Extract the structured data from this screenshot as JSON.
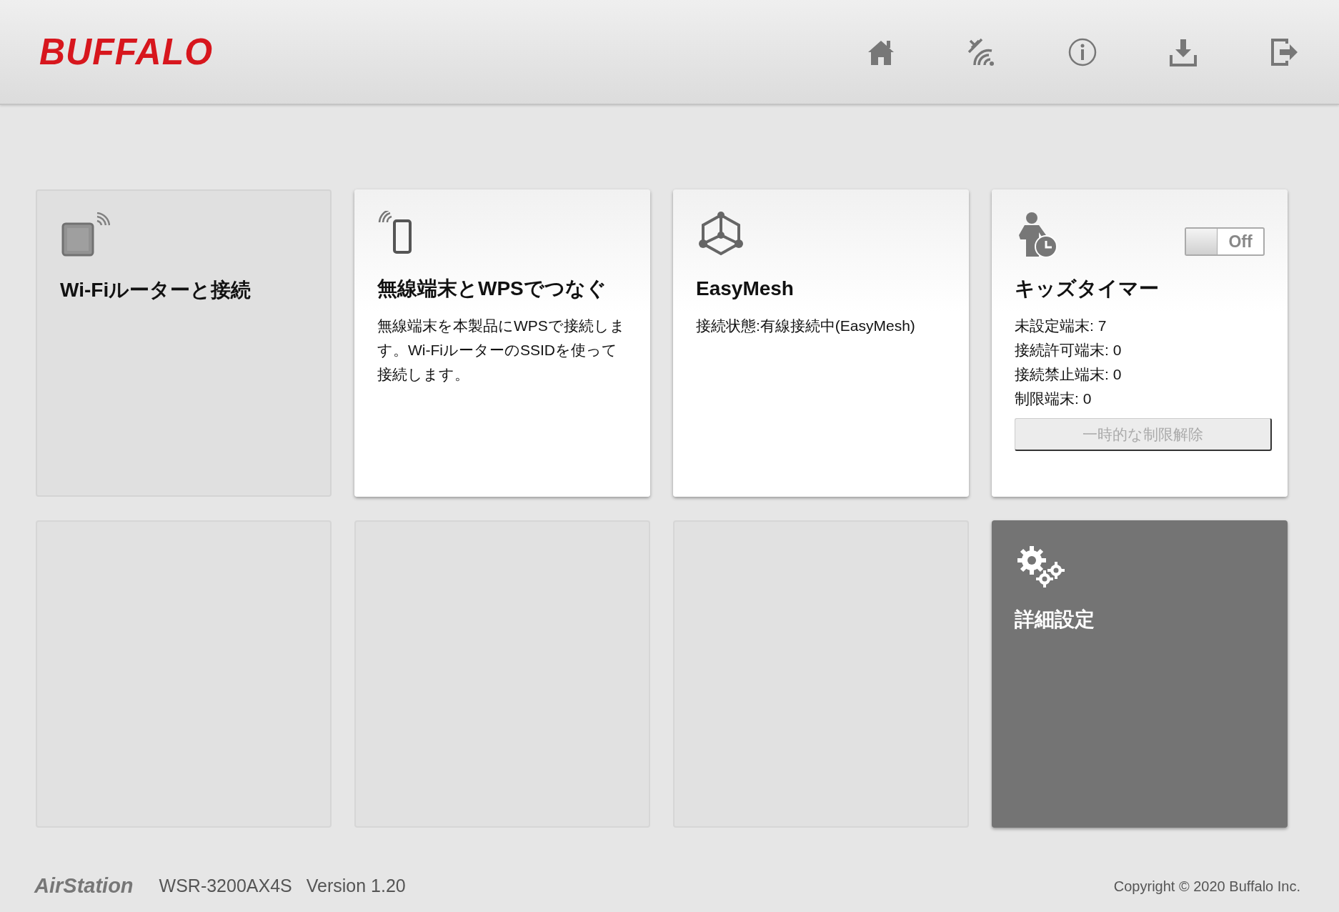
{
  "header": {
    "logo": "BUFFALO"
  },
  "tiles": [
    {
      "kind": "router",
      "disabled": true,
      "title": "Wi-Fiルーターと接続"
    },
    {
      "kind": "wps",
      "disabled": false,
      "title": "無線端末とWPSでつなぐ",
      "lines": [
        "無線端末を本製品にWPSで接続します。Wi-FiルーターのSSIDを使って接続します。"
      ]
    },
    {
      "kind": "mesh",
      "disabled": false,
      "title": "EasyMesh",
      "lines": [
        "接続状態:有線接続中(EasyMesh)"
      ]
    },
    {
      "kind": "kids",
      "disabled": false,
      "title": "キッズタイマー",
      "toggle": {
        "on": false,
        "label": "Off"
      },
      "lines": [
        "未設定端末: 7",
        "接続許可端末: 0",
        "接続禁止端末: 0",
        "制限端末: 0"
      ],
      "button": {
        "label": "一時的な制限解除",
        "disabled": true
      }
    },
    {
      "kind": "empty"
    },
    {
      "kind": "empty"
    },
    {
      "kind": "empty"
    },
    {
      "kind": "advanced",
      "disabled": false,
      "title": "詳細設定"
    }
  ],
  "footer": {
    "brand": "AirStation",
    "model": "WSR-3200AX4S",
    "version": "Version 1.20",
    "copyright": "Copyright © 2020 Buffalo Inc."
  }
}
